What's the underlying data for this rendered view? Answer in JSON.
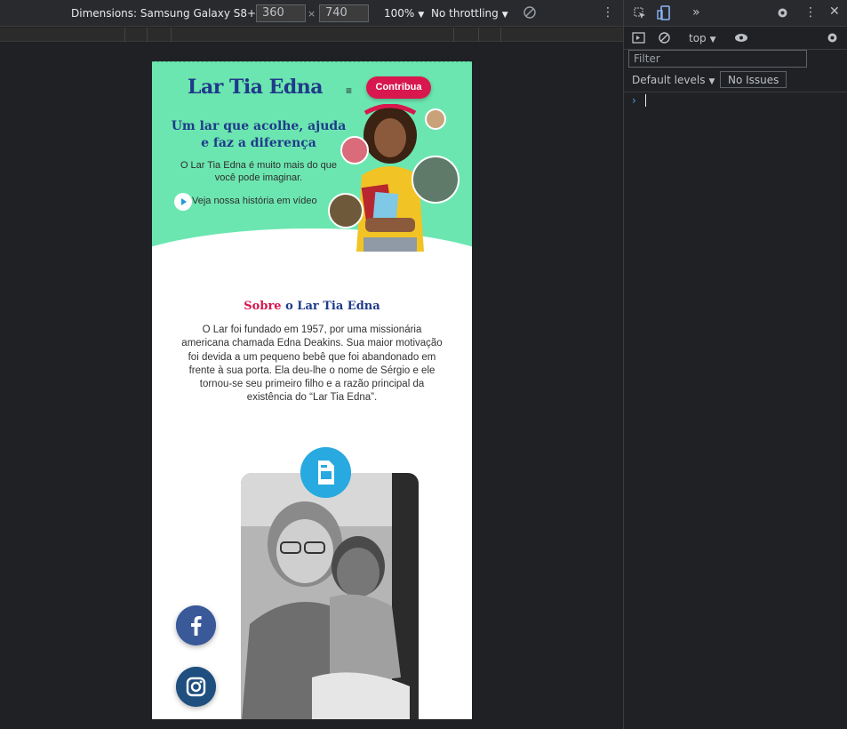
{
  "device_toolbar": {
    "dimensions_label": "Dimensions: Samsung Galaxy S8+",
    "width_value": "360",
    "height_value": "740",
    "times": "×",
    "zoom": "100%",
    "throttling": "No throttling"
  },
  "site": {
    "logo": "Lar Tia Edna",
    "menu_icon": "≡",
    "cta": "Contribua",
    "hero_title": "Um lar que acolhe, ajuda e faz a diferença",
    "hero_sub": "O Lar Tia Edna é muito mais do que você pode imaginar.",
    "video_link": "Veja nossa história em vídeo",
    "about_title_1": "Sobre",
    "about_title_2": " o Lar Tia Edna",
    "about_text": "O Lar foi fundado em 1957, por uma missionária americana chamada Edna Deakins. Sua maior motivação foi devida a um pequeno bebê que foi abandonado em frente à sua porta. Ela deu-lhe o nome de Sérgio e ele tornou-se seu primeiro filho e a razão principal da existência do “Lar Tia Edna”.",
    "colors": {
      "hero_bg": "#6ce6b0",
      "brand_blue": "#1f3a8a",
      "brand_pink": "#d8174e",
      "doc_blue": "#28a9e0",
      "facebook": "#3a5998",
      "instagram": "#1e4f7f"
    }
  },
  "devtools": {
    "context": "top",
    "filter_placeholder": "Filter",
    "levels": "Default levels",
    "issues": "No Issues",
    "prompt": "›"
  }
}
